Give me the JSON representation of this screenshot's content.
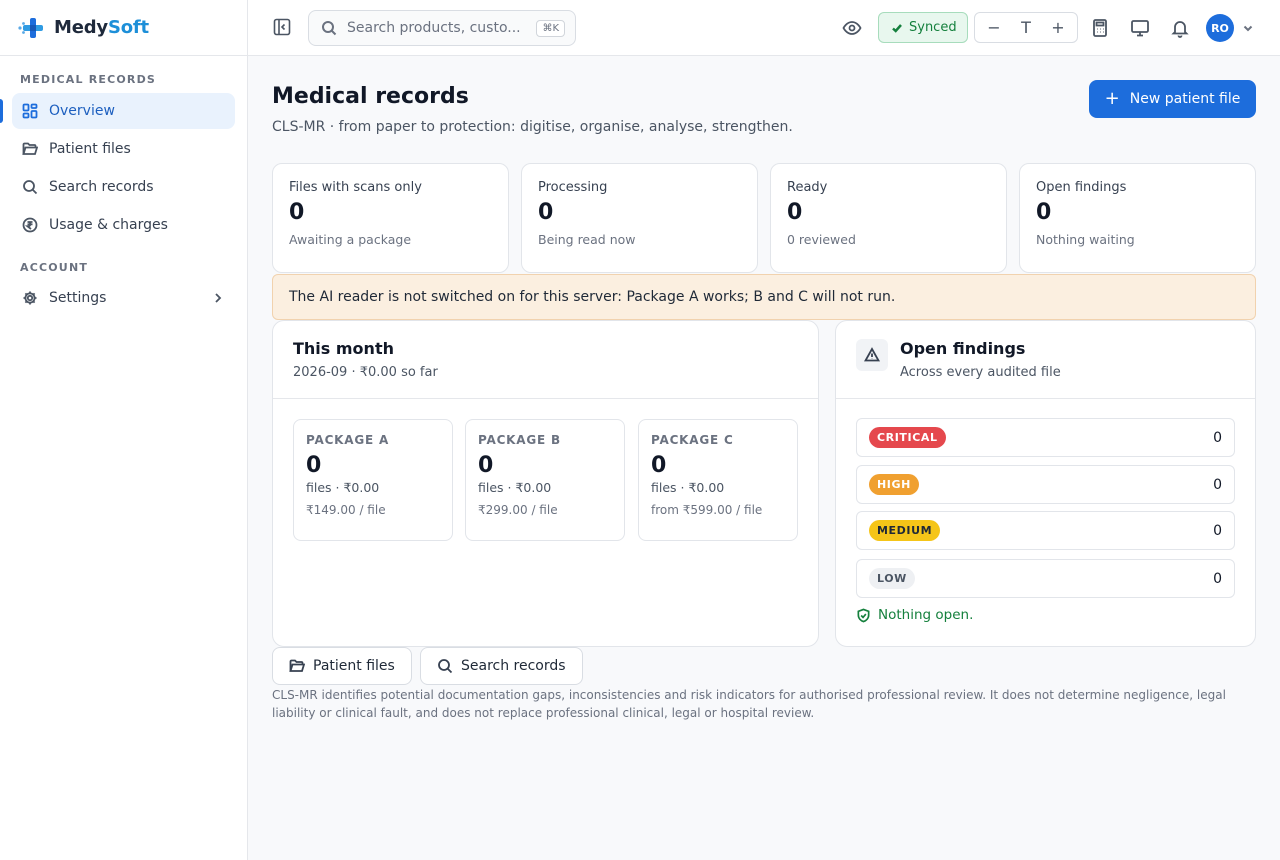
{
  "brand": {
    "name_part1": "Medy",
    "name_part2": "Soft"
  },
  "sidebar": {
    "section1_title": "MEDICAL RECORDS",
    "items": [
      {
        "label": "Overview",
        "icon": "layout-grid-icon"
      },
      {
        "label": "Patient files",
        "icon": "folder-open-icon"
      },
      {
        "label": "Search records",
        "icon": "search-icon"
      },
      {
        "label": "Usage & charges",
        "icon": "rupee-circle-icon"
      }
    ],
    "section2_title": "ACCOUNT",
    "settings_label": "Settings"
  },
  "topbar": {
    "search_placeholder": "Search products, custo...",
    "search_shortcut": "⌘K",
    "sync_status": "Synced",
    "text_decrease": "−",
    "text_size_symbol": "T",
    "text_increase": "+",
    "avatar_initials": "RO"
  },
  "header": {
    "title": "Medical records",
    "subtitle": "CLS-MR · from paper to protection: digitise, organise, analyse, strengthen.",
    "new_button_label": "New patient file"
  },
  "stats": [
    {
      "label": "Files with scans only",
      "value": "0",
      "note": "Awaiting a package"
    },
    {
      "label": "Processing",
      "value": "0",
      "note": "Being read now"
    },
    {
      "label": "Ready",
      "value": "0",
      "note": "0 reviewed"
    },
    {
      "label": "Open findings",
      "value": "0",
      "note": "Nothing waiting"
    }
  ],
  "banner": {
    "text": "The AI reader is not switched on for this server: Package A works; B and C will not run."
  },
  "month": {
    "title": "This month",
    "subtitle": "2026-09 · ₹0.00 so far",
    "packages": [
      {
        "name": "PACKAGE A",
        "count": "0",
        "files": "files · ₹0.00",
        "rate": "₹149.00 / file"
      },
      {
        "name": "PACKAGE B",
        "count": "0",
        "files": "files · ₹0.00",
        "rate": "₹299.00 / file"
      },
      {
        "name": "PACKAGE C",
        "count": "0",
        "files": "files · ₹0.00",
        "rate": "from ₹599.00 / file"
      }
    ]
  },
  "findings": {
    "title": "Open findings",
    "subtitle": "Across every audited file",
    "severities": [
      {
        "label": "CRITICAL",
        "count": "0",
        "bg": "#e5484d",
        "fg": "#ffffff"
      },
      {
        "label": "HIGH",
        "count": "0",
        "bg": "#f0a030",
        "fg": "#ffffff"
      },
      {
        "label": "MEDIUM",
        "count": "0",
        "bg": "#f5c518",
        "fg": "#1f2937"
      },
      {
        "label": "LOW",
        "count": "0",
        "bg": "#eef0f3",
        "fg": "#4b5563"
      }
    ],
    "empty_text": "Nothing open."
  },
  "footer_links": {
    "patient_files": "Patient files",
    "search_records": "Search records"
  },
  "disclaimer": "CLS-MR identifies potential documentation gaps, inconsistencies and risk indicators for authorised professional review. It does not determine negligence, legal liability or clinical fault, and does not replace professional clinical, legal or hospital review.",
  "colors": {
    "accent": "#1d6ddc",
    "brand_soft": "#1d8fd8",
    "success": "#15803d",
    "banner_bg": "#fbefe0"
  }
}
